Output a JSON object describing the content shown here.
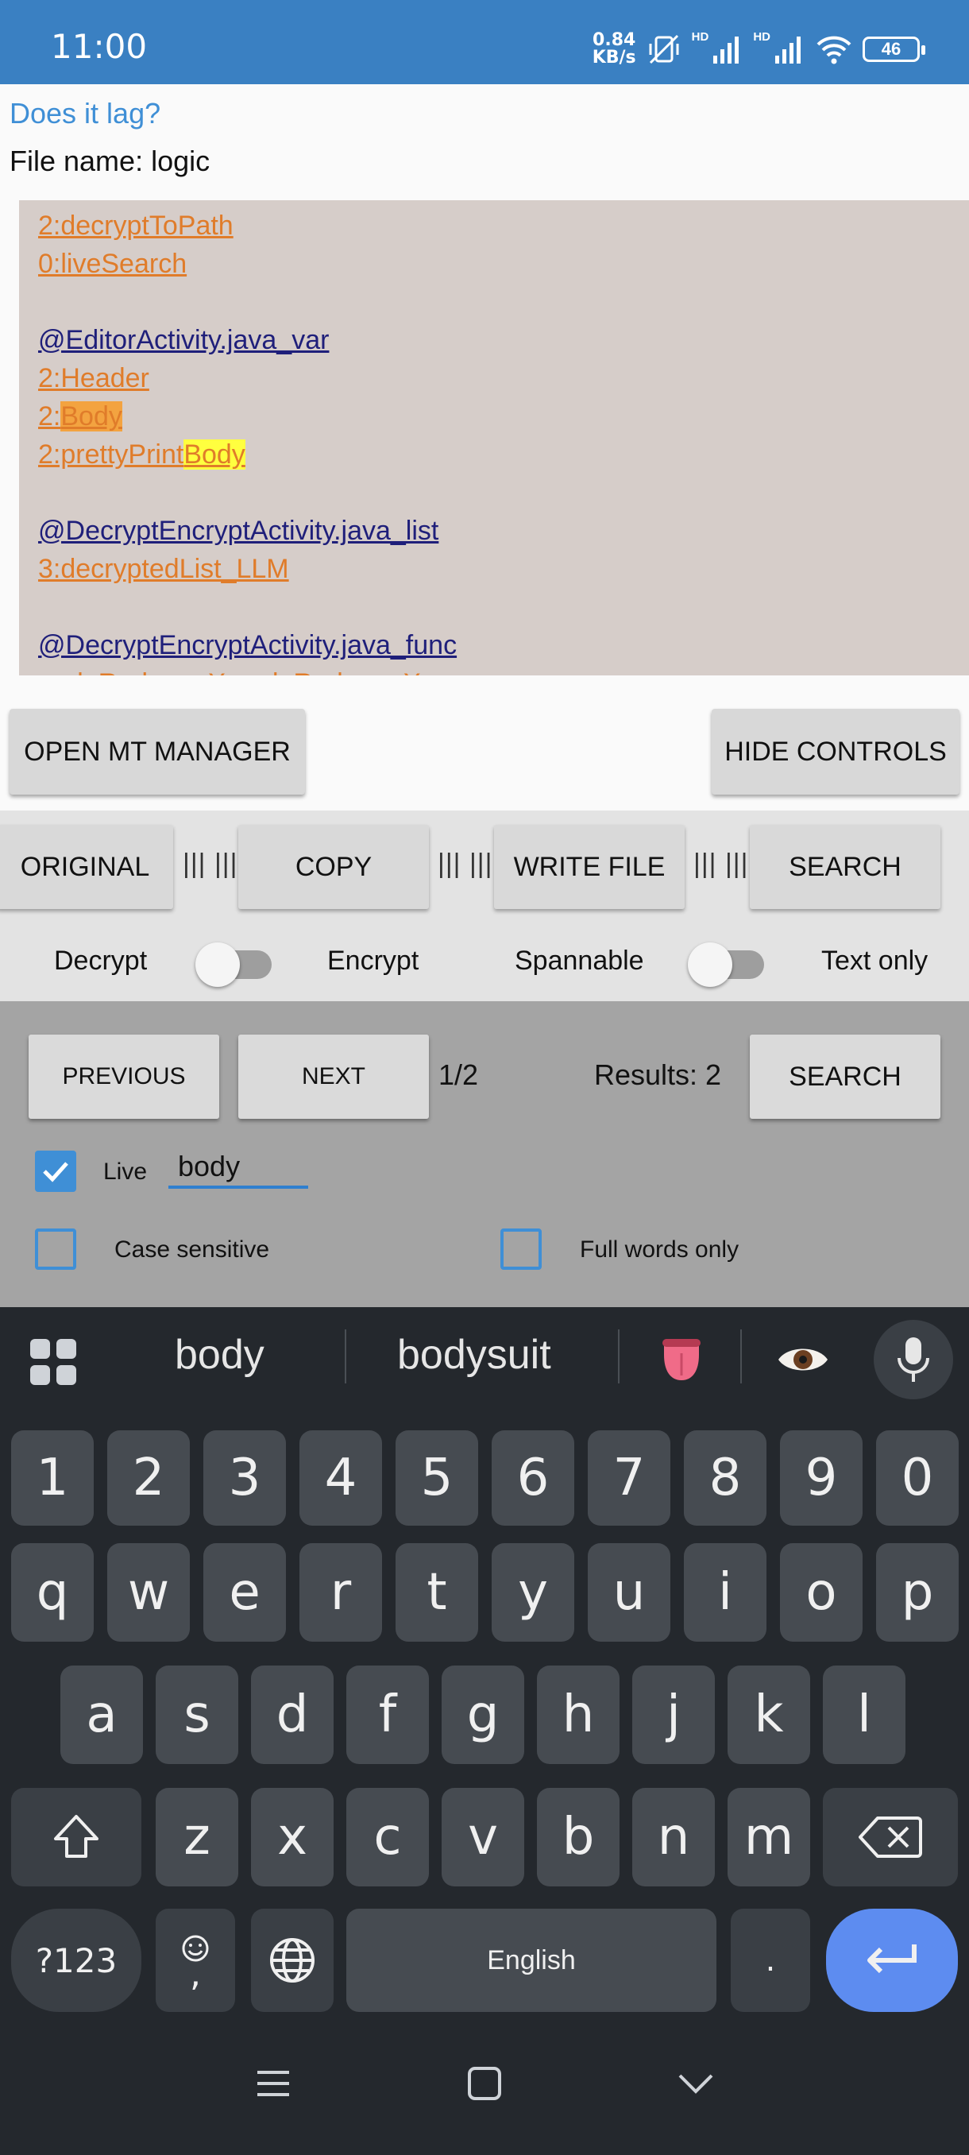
{
  "status_bar": {
    "time": "11:00",
    "net_speed_value": "0.84",
    "net_speed_unit": "KB/s",
    "hd1": "HD",
    "hd2": "HD",
    "battery": "46",
    "icons": [
      "mute-vibrate-icon",
      "signal-icon",
      "signal-icon",
      "wifi-icon",
      "battery-icon"
    ]
  },
  "app": {
    "lag_link": "Does it lag?",
    "file_name": "File name: logic"
  },
  "editor": {
    "l1": "2:decryptToPath",
    "l2": "0:liveSearch",
    "l3": "@EditorActivity.java_var",
    "l4": "2:Header",
    "l5_pre": "2:",
    "l5_hl": "Body",
    "l6_pre": "2:prettyPrint",
    "l6_hl": "Body",
    "l7": "@DecryptEncryptActivity.java_list",
    "l8": "3:decryptedList_LLM",
    "l9": "@DecryptEncryptActivity.java_func",
    "l10": "undoRedo___X;undoRedo___X"
  },
  "buttons": {
    "open_mt": "OPEN MT MANAGER",
    "hide_controls": "HIDE CONTROLS"
  },
  "toolbar": {
    "original": "ORIGINAL",
    "copy": "COPY",
    "write_file": "WRITE FILE",
    "search": "SEARCH",
    "sep": "||| |||",
    "decrypt": "Decrypt",
    "encrypt": "Encrypt",
    "spannable": "Spannable",
    "text_only": "Text only"
  },
  "search_panel": {
    "previous": "PREVIOUS",
    "next": "NEXT",
    "position": "1/2",
    "results": "Results: 2",
    "search": "SEARCH",
    "live_label": "Live",
    "live_checked": true,
    "query": "body",
    "case_sensitive": "Case sensitive",
    "case_checked": false,
    "full_words": "Full words only",
    "full_checked": false
  },
  "keyboard": {
    "suggestions": [
      "body",
      "bodysuit"
    ],
    "emoji_suggestions": [
      "tongue-emoji",
      "eye-emoji"
    ],
    "row_numbers": [
      "1",
      "2",
      "3",
      "4",
      "5",
      "6",
      "7",
      "8",
      "9",
      "0"
    ],
    "row1": [
      "q",
      "w",
      "e",
      "r",
      "t",
      "y",
      "u",
      "i",
      "o",
      "p"
    ],
    "row2": [
      "a",
      "s",
      "d",
      "f",
      "g",
      "h",
      "j",
      "k",
      "l"
    ],
    "row3": [
      "z",
      "x",
      "c",
      "v",
      "b",
      "n",
      "m"
    ],
    "sym_key": "?123",
    "comma": ",",
    "space_label": "English",
    "period": "."
  },
  "colors": {
    "status_bar": "#3a80c2",
    "accent": "#3f8fd6",
    "link_orange": "#e07c2a",
    "link_navy": "#1f1f7a",
    "highlight_yellow": "#ffff3f",
    "enter_key": "#5d8cf0"
  }
}
